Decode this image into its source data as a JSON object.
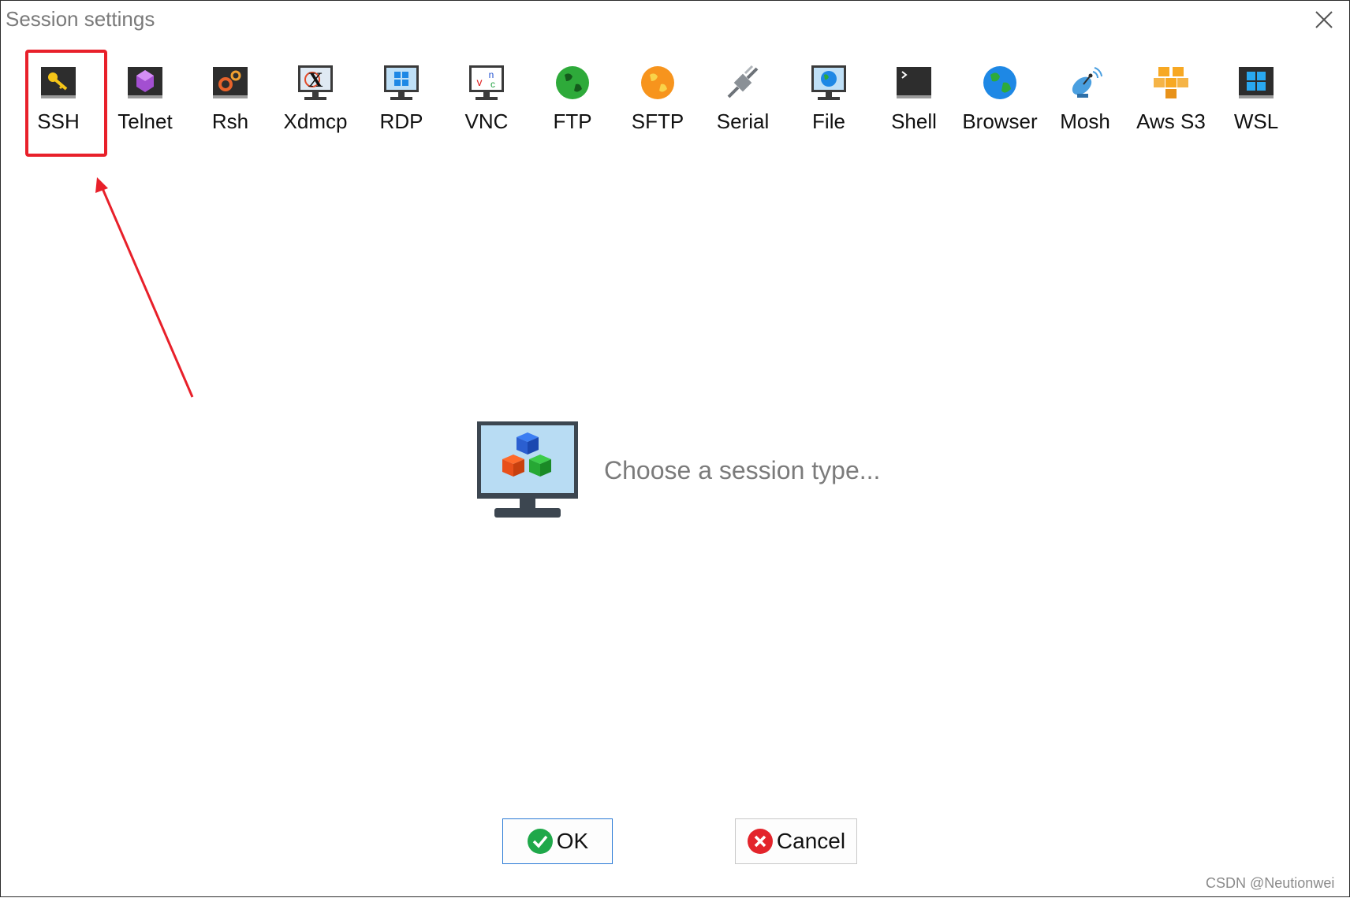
{
  "window": {
    "title": "Session settings"
  },
  "session_types": [
    {
      "label": "SSH",
      "icon": "ssh-key-icon"
    },
    {
      "label": "Telnet",
      "icon": "telnet-icon"
    },
    {
      "label": "Rsh",
      "icon": "rsh-gears-icon"
    },
    {
      "label": "Xdmcp",
      "icon": "xdmcp-icon"
    },
    {
      "label": "RDP",
      "icon": "rdp-windows-icon"
    },
    {
      "label": "VNC",
      "icon": "vnc-icon"
    },
    {
      "label": "FTP",
      "icon": "ftp-globe-icon"
    },
    {
      "label": "SFTP",
      "icon": "sftp-globe-icon"
    },
    {
      "label": "Serial",
      "icon": "serial-plug-icon"
    },
    {
      "label": "File",
      "icon": "file-globe-icon"
    },
    {
      "label": "Shell",
      "icon": "shell-terminal-icon"
    },
    {
      "label": "Browser",
      "icon": "browser-globe-icon"
    },
    {
      "label": "Mosh",
      "icon": "mosh-satellite-icon"
    },
    {
      "label": "Aws S3",
      "icon": "aws-s3-cubes-icon"
    },
    {
      "label": "WSL",
      "icon": "wsl-windows-icon"
    }
  ],
  "highlighted_session": "SSH",
  "main": {
    "prompt": "Choose a session type..."
  },
  "buttons": {
    "ok_label": "OK",
    "cancel_label": "Cancel"
  },
  "watermark": "CSDN @Neutionwei",
  "colors": {
    "highlight": "#e8202a",
    "ok_border": "#2a7ad6",
    "ok_icon": "#1fa84a",
    "cancel_icon": "#e3242b"
  }
}
